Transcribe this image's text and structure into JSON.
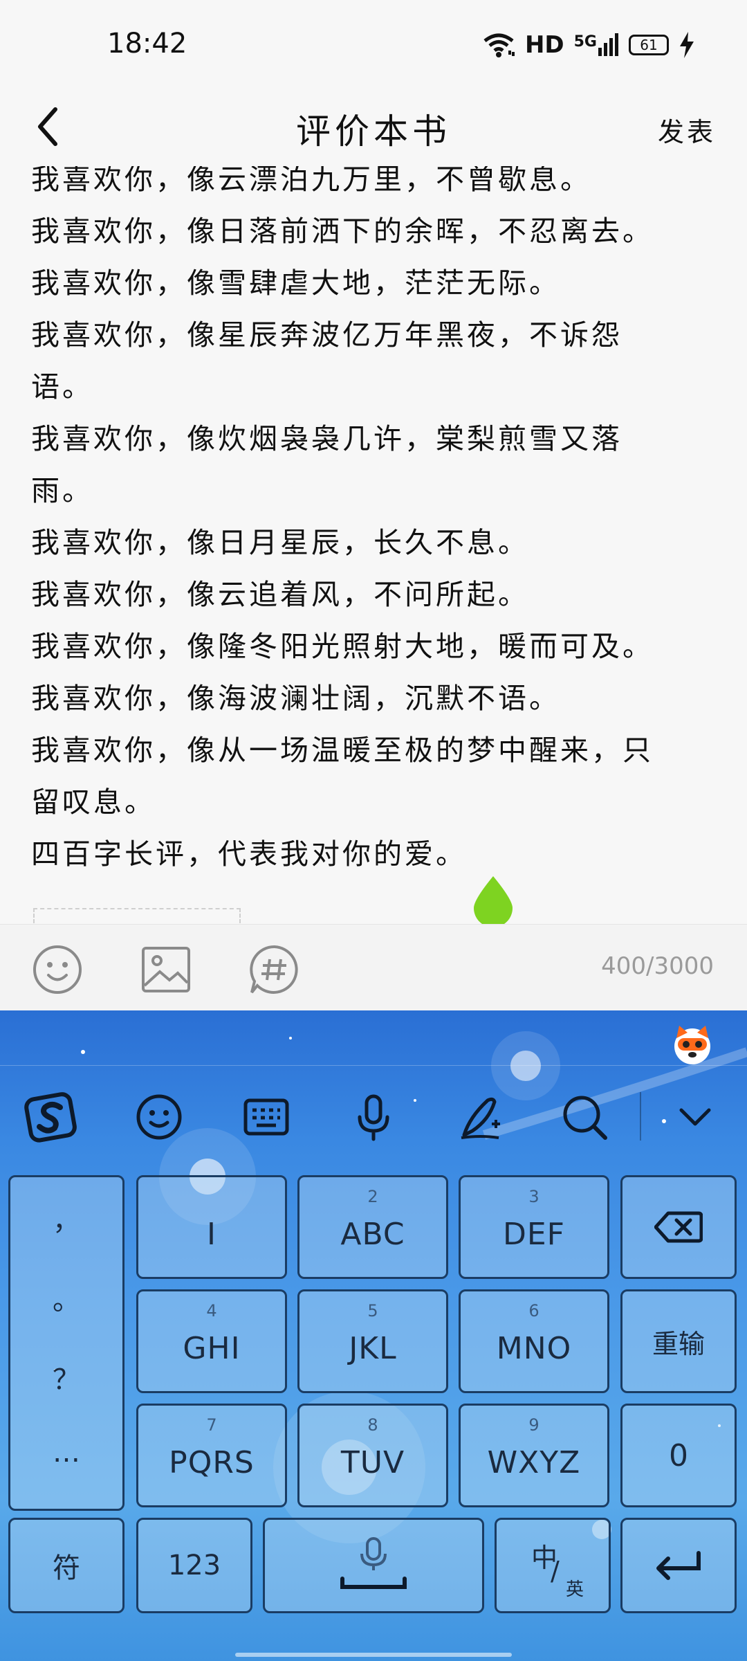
{
  "status_bar": {
    "time": "18:42",
    "hd": "HD",
    "network": "5G",
    "battery": "61"
  },
  "header": {
    "title": "评价本书",
    "publish_label": "发表"
  },
  "review": {
    "lines": [
      "我喜欢你，像云漂泊九万里，不曾歇息。",
      "我喜欢你，像日落前洒下的余晖，不忍离去。",
      "我喜欢你，像雪肆虐大地，茫茫无际。",
      "我喜欢你，像星辰奔波亿万年黑夜，不诉怨",
      "语。",
      "我喜欢你，像炊烟袅袅几许，棠梨煎雪又落",
      "雨。",
      "我喜欢你，像日月星辰，长久不息。",
      "我喜欢你，像云追着风，不问所起。",
      "我喜欢你，像隆冬阳光照射大地，暖而可及。",
      "我喜欢你，像海波澜壮阔，沉默不语。",
      "我喜欢你，像从一场温暖至极的梦中醒来，只",
      "留叹息。",
      "四百字长评，代表我对你的爱。"
    ]
  },
  "toolbar": {
    "icons": [
      "emoji-icon",
      "image-icon",
      "topic-hashtag-icon"
    ],
    "char_count": "400/3000"
  },
  "keyboard": {
    "colors": {
      "accent": "#1a3c63",
      "background": "#3a88e2"
    },
    "side_punctuation": [
      "，",
      "。",
      "？",
      "…"
    ],
    "keys": {
      "k1": {
        "label": "I"
      },
      "k2": {
        "num": "2",
        "label": "ABC"
      },
      "k3": {
        "num": "3",
        "label": "DEF"
      },
      "k4": {
        "num": "4",
        "label": "GHI"
      },
      "k5": {
        "num": "5",
        "label": "JKL"
      },
      "k6": {
        "num": "6",
        "label": "MNO"
      },
      "k7": {
        "num": "7",
        "label": "PQRS"
      },
      "k8": {
        "num": "8",
        "label": "TUV"
      },
      "k9": {
        "num": "9",
        "label": "WXYZ"
      },
      "retype": "重输",
      "zero": "0",
      "symbol": "符",
      "num123": "123",
      "lang_main": "中",
      "lang_sub": "英"
    }
  }
}
